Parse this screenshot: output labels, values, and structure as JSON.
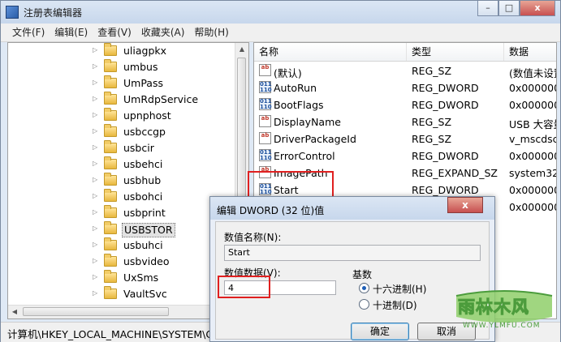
{
  "window": {
    "title": "注册表编辑器",
    "min": "–",
    "max": "□",
    "close": "x"
  },
  "menu": [
    "文件(F)",
    "编辑(E)",
    "查看(V)",
    "收藏夹(A)",
    "帮助(H)"
  ],
  "tree": {
    "items": [
      {
        "label": "uliagpkx"
      },
      {
        "label": "umbus"
      },
      {
        "label": "UmPass"
      },
      {
        "label": "UmRdpService"
      },
      {
        "label": "upnphost"
      },
      {
        "label": "usbccgp"
      },
      {
        "label": "usbcir"
      },
      {
        "label": "usbehci"
      },
      {
        "label": "usbhub"
      },
      {
        "label": "usbohci"
      },
      {
        "label": "usbprint"
      },
      {
        "label": "USBSTOR",
        "selected": true
      },
      {
        "label": "usbuhci"
      },
      {
        "label": "usbvideo"
      },
      {
        "label": "UxSms"
      },
      {
        "label": "VaultSvc"
      }
    ]
  },
  "list": {
    "columns": [
      "名称",
      "类型",
      "数据"
    ],
    "rows": [
      {
        "icon": "string-value-icon",
        "name": "(默认)",
        "type": "REG_SZ",
        "data": "(数值未设置"
      },
      {
        "icon": "binary-value-icon",
        "name": "AutoRun",
        "type": "REG_DWORD",
        "data": "0x000000"
      },
      {
        "icon": "binary-value-icon",
        "name": "BootFlags",
        "type": "REG_DWORD",
        "data": "0x000000"
      },
      {
        "icon": "string-value-icon",
        "name": "DisplayName",
        "type": "REG_SZ",
        "data": "USB 大容量"
      },
      {
        "icon": "string-value-icon",
        "name": "DriverPackageId",
        "type": "REG_SZ",
        "data": "v_mscdsc."
      },
      {
        "icon": "binary-value-icon",
        "name": "ErrorControl",
        "type": "REG_DWORD",
        "data": "0x000000"
      },
      {
        "icon": "string-value-icon",
        "name": "ImagePath",
        "type": "REG_EXPAND_SZ",
        "data": "system32\\"
      },
      {
        "icon": "binary-value-icon",
        "name": "Start",
        "type": "REG_DWORD",
        "data": "0x000000"
      },
      {
        "icon": "binary-value-icon",
        "name": "",
        "type": "",
        "data": "0x000000"
      }
    ]
  },
  "statusbar": {
    "path": "计算机\\HKEY_LOCAL_MACHINE\\SYSTEM\\Cu"
  },
  "dialog": {
    "title": "编辑 DWORD (32 位)值",
    "close": "x",
    "name_label": "数值名称(N):",
    "name_value": "Start",
    "data_label": "数值数据(V):",
    "data_value": "4",
    "base_label": "基数",
    "radio_hex": "十六进制(H)",
    "radio_dec": "十进制(D)",
    "ok": "确定",
    "cancel": "取消"
  },
  "watermark": {
    "text": "雨林木风",
    "url": "WWW.YLMFU.COM"
  }
}
